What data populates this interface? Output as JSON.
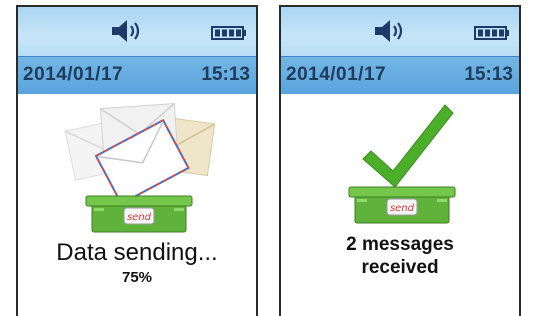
{
  "screens": [
    {
      "status": {
        "speaker_icon": "speaker-volume-icon",
        "battery_icon": "battery-full-icon"
      },
      "date": "2014/01/17",
      "time": "15:13",
      "status_text": "Data sending...",
      "progress": "75%",
      "illustration": {
        "icon": "envelopes-into-send-box-icon",
        "box_label": "send"
      }
    },
    {
      "status": {
        "speaker_icon": "speaker-volume-icon",
        "battery_icon": "battery-full-icon"
      },
      "date": "2014/01/17",
      "time": "15:13",
      "status_text_line1": "2 messages",
      "status_text_line2": "received",
      "illustration": {
        "icon": "checkmark-send-box-icon",
        "box_label": "send"
      }
    }
  ],
  "colors": {
    "status_bar": "#b8ddf5",
    "date_bar": "#5aa4dd",
    "box_green": "#5fb23a",
    "check_green": "#4caf2a"
  }
}
